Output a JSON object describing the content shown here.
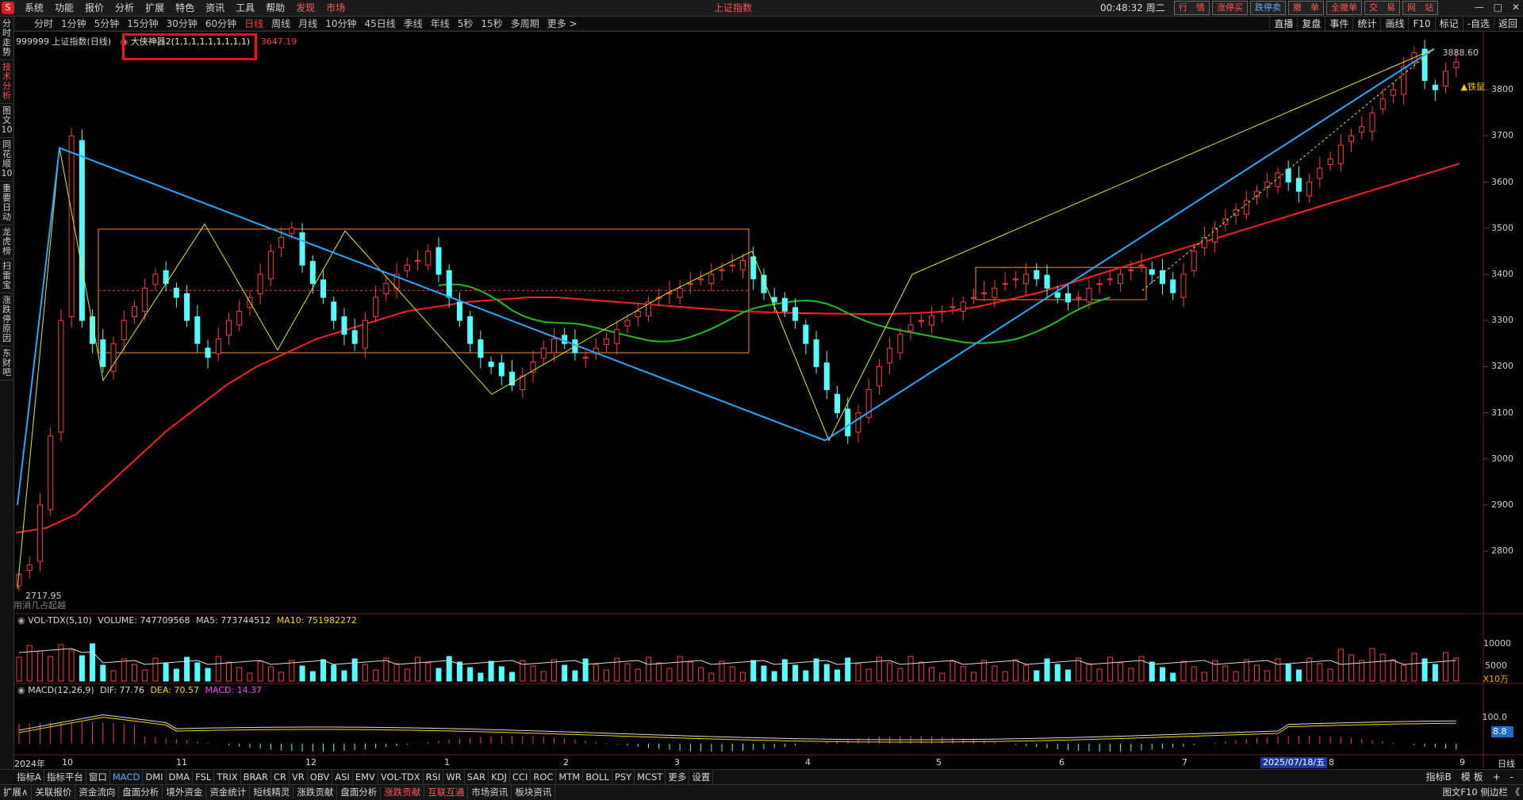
{
  "app": {
    "center_title": "上证指数",
    "clock": "00:48:32 周二",
    "menu": [
      "系统",
      "功能",
      "报价",
      "分析",
      "扩展",
      "特色",
      "资讯",
      "工具",
      "帮助"
    ],
    "menu_extra": [
      "发现",
      "市场"
    ],
    "trade_buttons": [
      "行　情",
      "涨停买",
      "跌停卖",
      "撤　单",
      "全撤单",
      "交　易",
      "网　站"
    ]
  },
  "periods": [
    "分时",
    "1分钟",
    "5分钟",
    "15分钟",
    "30分钟",
    "60分钟",
    "日线",
    "周线",
    "月线",
    "10分钟",
    "45日线",
    "季线",
    "年线",
    "5秒",
    "15秒",
    "多周期",
    "更多 >"
  ],
  "active_period": "日线",
  "right_tools": [
    "直播",
    "复盘",
    "事件",
    "统计",
    "画线",
    "F10",
    "标记",
    "-自选",
    "返回"
  ],
  "left_nav": [
    "分时走势",
    "技术分析",
    "图文10",
    "同花顺10",
    "重要日动",
    "龙虎榜",
    "扫雷宝",
    "涨跌停原因",
    "东财吧"
  ],
  "chart_info": {
    "symbol": "999999 上证指数(日线)",
    "indicator": "大侠神器2(1,1,1,1,1,1,1,1,1)",
    "indicator_value": "3647.19",
    "high_label": "3888.60",
    "low_label": "2717.95",
    "footnote": "用消几占起越",
    "tag": "▲铁鼠"
  },
  "price_axis": [
    "3800",
    "3700",
    "3600",
    "3500",
    "3400",
    "3300",
    "3200",
    "3100",
    "3000",
    "2900",
    "2800"
  ],
  "volume": {
    "legend_name": "VOL-TDX(5,10)",
    "volume_label": "VOLUME: 747709568",
    "ma5_label": "MA5: 773744512",
    "ma10_label": "MA10: 751982272",
    "axis": [
      "10000",
      "5000"
    ],
    "unit": "X10万"
  },
  "macd": {
    "legend_name": "MACD(12,26,9)",
    "dif_label": "DIF: 77.76",
    "dea_label": "DEA: 70.57",
    "macd_label": "MACD: 14.37",
    "axis": [
      "100.0"
    ],
    "current": "8.8"
  },
  "time_axis": {
    "labels": [
      "2024年",
      "10",
      "11",
      "12",
      "1",
      "2",
      "3",
      "4",
      "5",
      "6",
      "7",
      "8",
      "9"
    ],
    "cursor_date": "2025/07/18/五",
    "right_label": "日线"
  },
  "bottom_tabs": [
    "指标A",
    "指标平台",
    "窗口",
    "MACD",
    "DMI",
    "DMA",
    "FSL",
    "TRIX",
    "BRAR",
    "CR",
    "VR",
    "OBV",
    "ASI",
    "EMV",
    "VOL-TDX",
    "RSI",
    "WR",
    "SAR",
    "KDJ",
    "CCI",
    "ROC",
    "MTM",
    "BOLL",
    "PSY",
    "MCST",
    "更多",
    "设置"
  ],
  "active_tab": "MACD",
  "bottom_right": [
    "指标B",
    "模 板",
    "+",
    "-"
  ],
  "status_items": [
    "扩展∧",
    "关联报价",
    "资金流向",
    "盘面分析",
    "境外资金",
    "资金统计",
    "短线精灵",
    "涨跌贡献",
    "盘面分析",
    "涨跌贡献",
    "互联互通",
    "市场资讯",
    "板块资讯"
  ],
  "status_right": "图文F10 侧边栏 《",
  "colors": {
    "up": "#ff3b3b",
    "down": "#54ffff",
    "ma_red": "#ff2020",
    "ma_green": "#20c020",
    "trend_blue": "#2aa8ff",
    "zig_yellow": "#e8e830",
    "box_orange": "#ff8c2a"
  },
  "chart_data": {
    "type": "candlestick",
    "title": "999999 上证指数(日线)",
    "ylim": [
      2680,
      3900
    ],
    "months": [
      "2024-09",
      "2024-10",
      "2024-11",
      "2024-12",
      "2025-01",
      "2025-02",
      "2025-03",
      "2025-04",
      "2025-05",
      "2025-06",
      "2025-07",
      "2025-08",
      "2025-09"
    ],
    "close_series": [
      2750,
      2770,
      2900,
      3050,
      3300,
      3700,
      3300,
      3250,
      3200,
      3250,
      3300,
      3330,
      3370,
      3400,
      3380,
      3350,
      3300,
      3250,
      3220,
      3260,
      3300,
      3320,
      3350,
      3400,
      3450,
      3480,
      3500,
      3420,
      3380,
      3350,
      3300,
      3270,
      3250,
      3300,
      3350,
      3380,
      3400,
      3420,
      3430,
      3450,
      3400,
      3350,
      3300,
      3250,
      3220,
      3200,
      3180,
      3160,
      3180,
      3210,
      3240,
      3260,
      3250,
      3230,
      3220,
      3240,
      3260,
      3280,
      3300,
      3320,
      3340,
      3350,
      3360,
      3370,
      3380,
      3390,
      3400,
      3410,
      3420,
      3430,
      3390,
      3360,
      3340,
      3320,
      3300,
      3250,
      3200,
      3150,
      3100,
      3050,
      3100,
      3150,
      3200,
      3240,
      3270,
      3290,
      3300,
      3310,
      3320,
      3330,
      3340,
      3350,
      3360,
      3370,
      3380,
      3390,
      3400,
      3390,
      3370,
      3350,
      3340,
      3350,
      3370,
      3380,
      3390,
      3400,
      3410,
      3420,
      3400,
      3380,
      3360,
      3400,
      3450,
      3480,
      3500,
      3520,
      3540,
      3560,
      3580,
      3600,
      3620,
      3600,
      3580,
      3600,
      3630,
      3650,
      3680,
      3700,
      3720,
      3750,
      3780,
      3800,
      3850,
      3880,
      3820,
      3800,
      3840,
      3860
    ],
    "ma_long": [
      2840,
      2850,
      2880,
      2940,
      3000,
      3060,
      3110,
      3160,
      3200,
      3230,
      3260,
      3280,
      3300,
      3320,
      3330,
      3340,
      3345,
      3350,
      3350,
      3345,
      3340,
      3335,
      3330,
      3325,
      3320,
      3318,
      3316,
      3315,
      3314,
      3314,
      3316,
      3320,
      3330,
      3345,
      3360,
      3380,
      3400,
      3420,
      3440,
      3460,
      3480,
      3500,
      3520,
      3540,
      3560,
      3580,
      3600,
      3620,
      3640
    ],
    "zigzag": [
      [
        2717.95,
        "2024-09-24"
      ],
      [
        3674,
        "2024-10-08"
      ],
      [
        3170,
        "2024-10-18"
      ],
      [
        3509,
        "2024-11-08"
      ],
      [
        3236,
        "2024-11-21"
      ],
      [
        3494,
        "2024-12-11"
      ],
      [
        3140,
        "2025-01-13"
      ],
      [
        3358,
        "2025-02-10"
      ],
      [
        3450,
        "2025-03-18"
      ],
      [
        3040,
        "2025-04-07"
      ],
      [
        3400,
        "2025-05-14"
      ],
      [
        3888.6,
        "2025-08-28"
      ]
    ],
    "volume_last": 747709568,
    "macd_last": {
      "dif": 77.76,
      "dea": 70.57,
      "macd": 14.37
    }
  }
}
